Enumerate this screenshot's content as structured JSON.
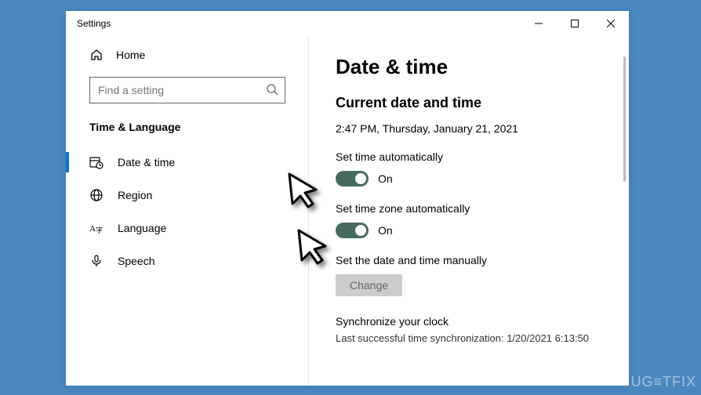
{
  "window": {
    "title": "Settings"
  },
  "sidebar": {
    "home_label": "Home",
    "search_placeholder": "Find a setting",
    "section_label": "Time & Language",
    "items": [
      {
        "label": "Date & time"
      },
      {
        "label": "Region"
      },
      {
        "label": "Language"
      },
      {
        "label": "Speech"
      }
    ]
  },
  "main": {
    "heading": "Date & time",
    "subheading": "Current date and time",
    "current_datetime": "2:47 PM, Thursday, January 21, 2021",
    "auto_time_label": "Set time automatically",
    "auto_time_state": "On",
    "auto_zone_label": "Set time zone automatically",
    "auto_zone_state": "On",
    "manual_label": "Set the date and time manually",
    "change_button": "Change",
    "sync_heading": "Synchronize your clock",
    "sync_last": "Last successful time synchronization: 1/20/2021 6:13:50"
  },
  "watermark": "UG≡TFIX"
}
